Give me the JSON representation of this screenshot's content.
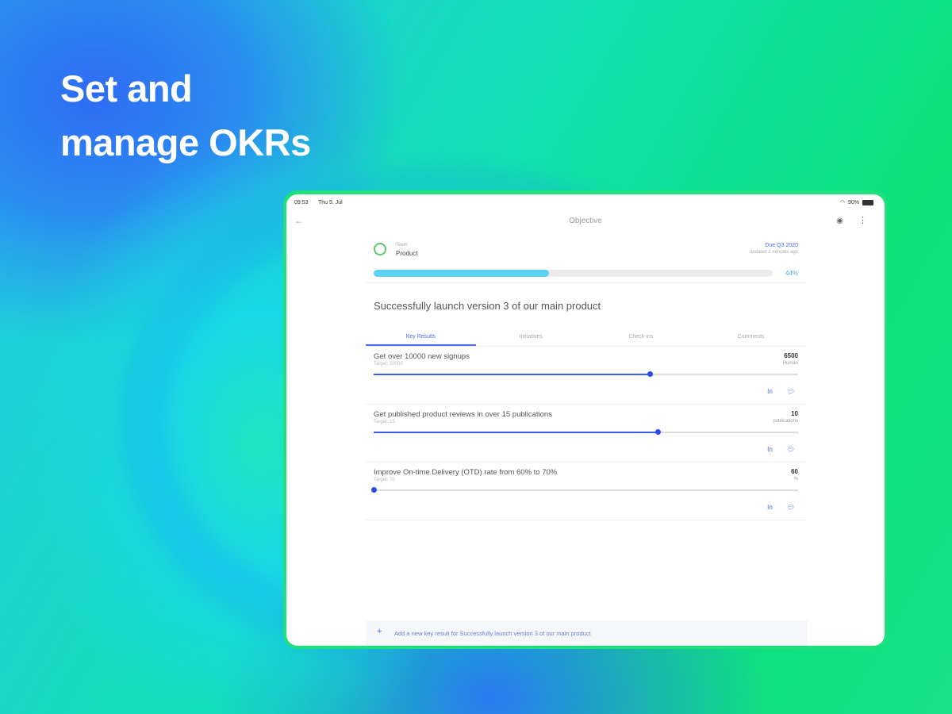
{
  "headline": {
    "line1": "Set and",
    "line2": "manage OKRs"
  },
  "status_bar": {
    "time": "09:53",
    "date": "Thu 5. Jul",
    "battery": "90%"
  },
  "navbar": {
    "title": "Objective"
  },
  "objective": {
    "team_label": "Team",
    "team_name": "Product",
    "due": "Due Q3 2020",
    "updated": "updated 2 minutes ago",
    "progress_percent": 44,
    "progress_label": "44%",
    "title": "Successfully launch version 3 of our main product"
  },
  "tabs": [
    {
      "label": "Key Results",
      "active": true
    },
    {
      "label": "Initiatives",
      "active": false
    },
    {
      "label": "Check-ins",
      "active": false
    },
    {
      "label": "Comments",
      "active": false
    }
  ],
  "key_results": [
    {
      "title": "Get over 10000 new signups",
      "target": "Target: 10000",
      "value": "6500",
      "unit": "Human",
      "progress": 0.65
    },
    {
      "title": "Get published product reviews in over 15 publications",
      "target": "Target: 15",
      "value": "10",
      "unit": "publications",
      "progress": 0.67
    },
    {
      "title": "Improve On-time Delivery (OTD) rate from 60% to 70%",
      "target": "Target: 70",
      "value": "60",
      "unit": "%",
      "progress": 0.0
    }
  ],
  "kr_actions": {
    "checkin": "In",
    "comment": "comment"
  },
  "add_bar": {
    "text": "Add a new key result for Successfully launch version 3 of our main product"
  },
  "colors": {
    "accent": "#4a6cf7",
    "progress": "#5cd0f5",
    "device_frame": "#1fe07a"
  }
}
